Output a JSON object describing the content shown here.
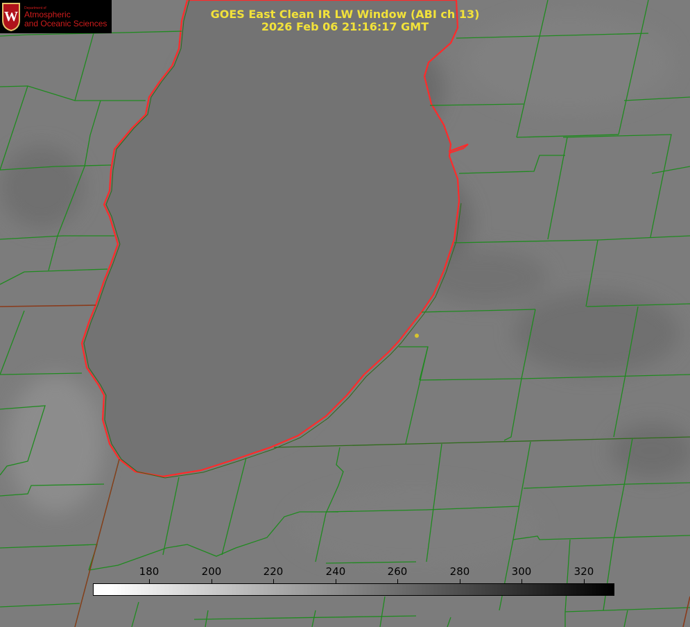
{
  "header": {
    "title_line1": "GOES East Clean IR LW Window (ABI ch 13)",
    "title_line2": "2026 Feb 06 21:16:17 GMT"
  },
  "logo": {
    "dept": "Department of",
    "line1": "Atmospheric",
    "line2": "and Oceanic Sciences",
    "seal_letter": "W",
    "accent_color": "#d01c1c"
  },
  "colorbar": {
    "ticks": [
      "180",
      "200",
      "220",
      "240",
      "260",
      "280",
      "300",
      "320"
    ]
  },
  "colors": {
    "title": "#f2e23a",
    "county_lines": "#1f8a1f",
    "shoreline": "#ff2a2a",
    "marker": "#d7c42e"
  }
}
